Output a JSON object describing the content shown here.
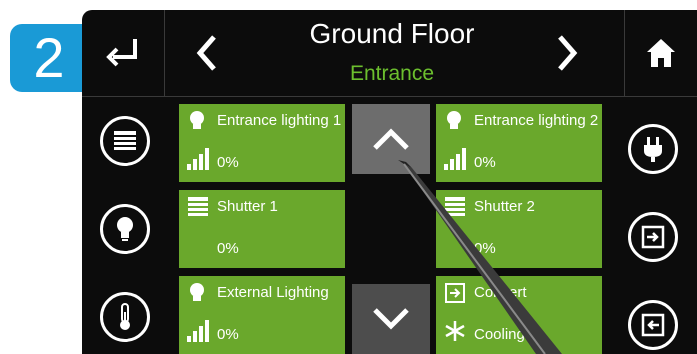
{
  "step_badge": "2",
  "header": {
    "title": "Ground Floor",
    "subtitle": "Entrance"
  },
  "tiles": [
    {
      "name": "Entrance lighting 1",
      "value": "0%"
    },
    {
      "name": "Entrance lighting 2",
      "value": "0%"
    },
    {
      "name": "Shutter 1",
      "value": "0%"
    },
    {
      "name": "Shutter 2",
      "value": "0%"
    },
    {
      "name": "External Lighting",
      "value": "0%"
    },
    {
      "name": "Convert",
      "value": "Cooling"
    }
  ],
  "colors": {
    "accent_green": "#6aa82c",
    "subtitle_green": "#6cbf2e",
    "badge_blue": "#1a9ad6"
  },
  "icons": [
    "return-icon",
    "chevron-left-icon",
    "chevron-right-icon",
    "home-icon",
    "shutter-icon",
    "bulb-icon",
    "thermometer-icon",
    "plug-icon",
    "enter-icon",
    "exit-icon",
    "signal-bars-icon",
    "snowflake-icon"
  ]
}
